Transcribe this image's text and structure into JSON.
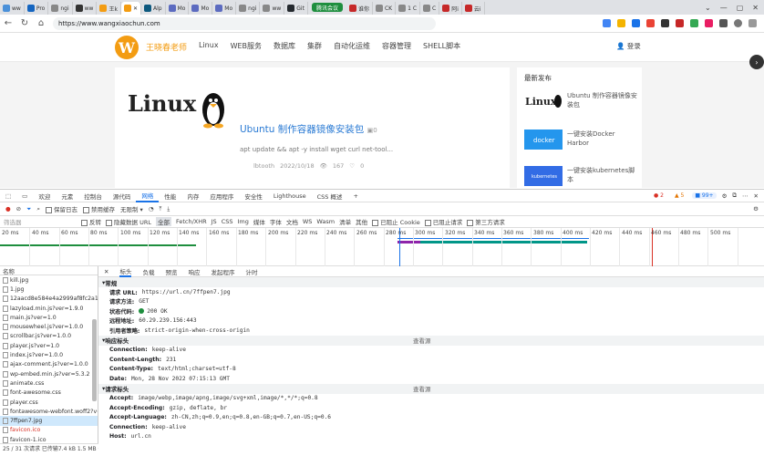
{
  "browser": {
    "tabs": [
      {
        "label": "ww",
        "color": "#4a90d9"
      },
      {
        "label": "Pro",
        "color": "#1565c0"
      },
      {
        "label": "ngi",
        "color": "#888"
      },
      {
        "label": "ww",
        "color": "#333"
      },
      {
        "label": "王k",
        "color": "#f39c12",
        "active": false
      },
      {
        "label": "",
        "color": "#f39c12",
        "active": true
      },
      {
        "label": "Alp",
        "color": "#0d597f"
      },
      {
        "label": "Mo",
        "color": "#5c6bc0"
      },
      {
        "label": "Mo",
        "color": "#5c6bc0"
      },
      {
        "label": "Mo",
        "color": "#5c6bc0"
      },
      {
        "label": "ngi",
        "color": "#888"
      },
      {
        "label": "ww",
        "color": "#888"
      },
      {
        "label": "Git",
        "color": "#24292e"
      }
    ],
    "cast_label": "腾讯会议",
    "tabs_right": [
      {
        "label": "谁你",
        "color": "#c62828"
      },
      {
        "label": "CK",
        "color": "#888"
      },
      {
        "label": "1 C",
        "color": "#888"
      },
      {
        "label": "C",
        "color": "#888"
      },
      {
        "label": "阿i",
        "color": "#c62828"
      },
      {
        "label": "云i",
        "color": "#c62828"
      }
    ],
    "window_controls": [
      "⌄",
      "—",
      "▢",
      "✕"
    ],
    "url": "https://www.wangxiaochun.com",
    "nav": {
      "back": "←",
      "forward": "→",
      "reload": "↻",
      "home": "⌂"
    }
  },
  "site": {
    "logo_letter": "W",
    "name": "王晓春老师",
    "nav": [
      "Linux",
      "WEB服务",
      "数据库",
      "集群",
      "自动化运维",
      "容器管理",
      "SHELL脚本"
    ],
    "login": "登录",
    "article": {
      "thumb_text": "Linux",
      "title": "Ubuntu 制作容器镜像安装包",
      "comments_count": "0",
      "excerpt": "apt update && apt -y install wget curl net-tool...",
      "author": "lbtooth",
      "date": "2022/10/18",
      "views": "167",
      "likes": "0"
    },
    "sidebar": {
      "heading": "最新发布",
      "items": [
        {
          "title": "Ubuntu 制作容器镜像安装包",
          "thumb": "Linux"
        },
        {
          "title": "一键安装Docker Harbor",
          "thumb": "docker"
        },
        {
          "title": "一键安装kubernetes脚本",
          "thumb": "kubernetes"
        }
      ]
    }
  },
  "devtools": {
    "tabs": [
      "欢迎",
      "元素",
      "控制台",
      "源代码",
      "网络",
      "性能",
      "内存",
      "应用程序",
      "安全性",
      "Lighthouse",
      "CSS 概述"
    ],
    "active_tab": "网络",
    "errors": "2",
    "warnings": "5",
    "issues": "99+",
    "toolbar": {
      "preserve_log": "保留日志",
      "disable_cache": "禁用缓存",
      "throttle": "无限制"
    },
    "filter": {
      "placeholder": "筛选器",
      "invert": "反转",
      "hide_data_urls": "隐藏数据 URL",
      "types": [
        "全部",
        "Fetch/XHR",
        "JS",
        "CSS",
        "Img",
        "媒体",
        "字体",
        "文档",
        "WS",
        "Wasm",
        "清单",
        "其他"
      ],
      "blocked_cookies": "已阻止 Cookie",
      "blocked_requests": "已阻止请求",
      "third_party": "第三方请求"
    },
    "timeline_ticks": [
      "20 ms",
      "40 ms",
      "60 ms",
      "80 ms",
      "100 ms",
      "120 ms",
      "140 ms",
      "160 ms",
      "180 ms",
      "200 ms",
      "220 ms",
      "240 ms",
      "260 ms",
      "280 ms",
      "300 ms",
      "320 ms",
      "340 ms",
      "360 ms",
      "380 ms",
      "400 ms",
      "420 ms",
      "440 ms",
      "460 ms",
      "480 ms",
      "500 ms"
    ],
    "name_header": "名称",
    "requests": [
      {
        "name": "kill.jpg"
      },
      {
        "name": "1.jpg"
      },
      {
        "name": "12aacd8e584e4a2999af8fc2a1b98"
      },
      {
        "name": "lazyload.min.js?ver=1.9.0"
      },
      {
        "name": "main.js?ver=1.0"
      },
      {
        "name": "mousewheel.js?ver=1.0.0"
      },
      {
        "name": "scrollbar.js?ver=1.0.0"
      },
      {
        "name": "player.js?ver=1.0"
      },
      {
        "name": "index.js?ver=1.0.0"
      },
      {
        "name": "ajax-comment.js?ver=1.0.0"
      },
      {
        "name": "wp-embed.min.js?ver=5.3.2"
      },
      {
        "name": "animate.css"
      },
      {
        "name": "font-awesome.css"
      },
      {
        "name": "player.css"
      },
      {
        "name": "fontawesome-webfont.woff2?v=4"
      },
      {
        "name": "7ffpen7.jpg",
        "selected": true
      },
      {
        "name": "favicon.ico",
        "error": true
      },
      {
        "name": "favicon-1.ico"
      }
    ],
    "status_bar": "25 / 31 次请求  已传输7.4 kB  1.5 MB 条资源",
    "detail_tabs": [
      "标头",
      "负载",
      "预览",
      "响应",
      "发起程序",
      "计时"
    ],
    "general": {
      "title": "常规",
      "rows": [
        {
          "k": "请求 URL:",
          "v": "https://url.cn/7ffpen7.jpg"
        },
        {
          "k": "请求方法:",
          "v": "GET"
        },
        {
          "k": "状态代码:",
          "v": "200 OK"
        },
        {
          "k": "远程地址:",
          "v": "60.29.239.156:443"
        },
        {
          "k": "引用者策略:",
          "v": "strict-origin-when-cross-origin"
        }
      ]
    },
    "response_headers": {
      "title": "响应标头",
      "view_source": "查看源",
      "rows": [
        {
          "k": "Connection:",
          "v": "keep-alive"
        },
        {
          "k": "Content-Length:",
          "v": "231"
        },
        {
          "k": "Content-Type:",
          "v": "text/html;charset=utf-8"
        },
        {
          "k": "Date:",
          "v": "Mon, 28 Nov 2022 07:15:13 GMT"
        }
      ]
    },
    "request_headers": {
      "title": "请求标头",
      "view_source": "查看源",
      "rows": [
        {
          "k": "Accept:",
          "v": "image/webp,image/apng,image/svg+xml,image/*,*/*;q=0.8"
        },
        {
          "k": "Accept-Encoding:",
          "v": "gzip, deflate, br"
        },
        {
          "k": "Accept-Language:",
          "v": "zh-CN,zh;q=0.9,en;q=0.8,en-GB;q=0.7,en-US;q=0.6"
        },
        {
          "k": "Connection:",
          "v": "keep-alive"
        },
        {
          "k": "Host:",
          "v": "url.cn"
        }
      ]
    }
  }
}
